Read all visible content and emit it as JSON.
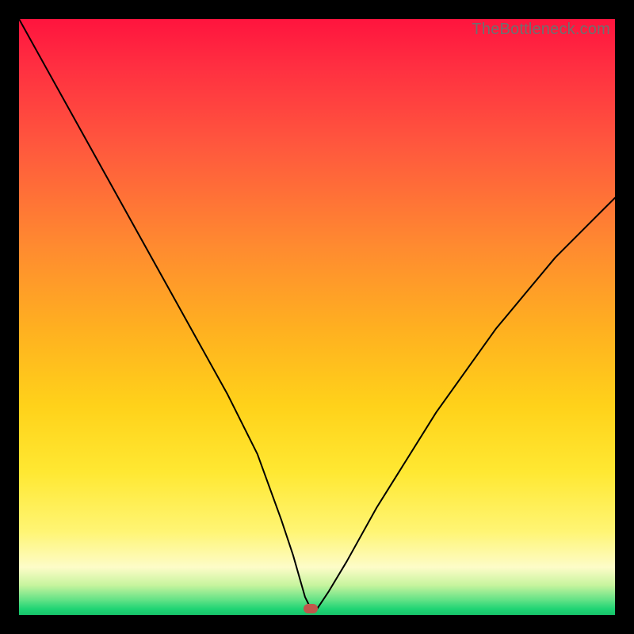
{
  "watermark": "TheBottleneck.com",
  "marker": {
    "x_pct": 49.0,
    "y_pct": 99.0
  },
  "colors": {
    "frame": "#000000",
    "curve": "#000000",
    "marker": "#c0564b",
    "gradient_top": "#ff143e",
    "gradient_bottom": "#17c26a"
  },
  "chart_data": {
    "type": "line",
    "title": "",
    "xlabel": "",
    "ylabel": "",
    "xlim": [
      0,
      100
    ],
    "ylim": [
      0,
      100
    ],
    "grid": false,
    "legend": false,
    "annotations": [
      "TheBottleneck.com"
    ],
    "series": [
      {
        "name": "bottleneck-curve",
        "x": [
          0,
          5,
          10,
          15,
          20,
          25,
          30,
          35,
          40,
          44,
          46,
          48,
          49,
          50,
          52,
          55,
          60,
          65,
          70,
          75,
          80,
          85,
          90,
          95,
          100
        ],
        "y": [
          100,
          91,
          82,
          73,
          64,
          55,
          46,
          37,
          27,
          16,
          10,
          3,
          1,
          1,
          4,
          9,
          18,
          26,
          34,
          41,
          48,
          54,
          60,
          65,
          70
        ]
      }
    ],
    "minimum_point": {
      "x": 49,
      "y": 1
    },
    "background": "vertical-gradient red→yellow→green (value heatmap)",
    "notes": "No axis ticks or numeric labels are rendered; values are read as percentages of the plot area. Curve is a V-shaped bottleneck profile with minimum near x≈49%."
  }
}
